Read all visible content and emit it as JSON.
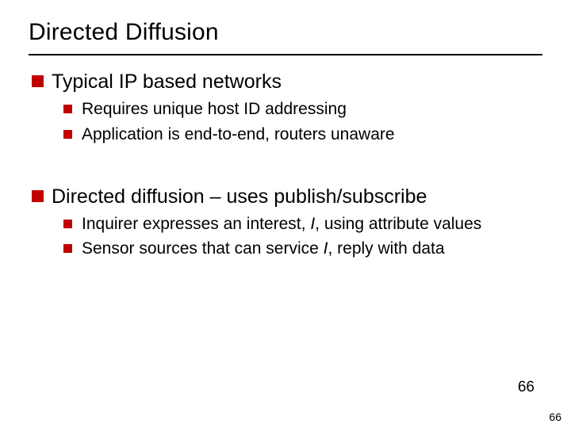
{
  "title": "Directed Diffusion",
  "sections": [
    {
      "heading": "Typical IP based networks",
      "items": [
        {
          "text": "Requires unique host ID addressing"
        },
        {
          "text": "Application is end-to-end, routers unaware"
        }
      ]
    },
    {
      "heading": "Directed diffusion – uses publish/subscribe",
      "items": [
        {
          "pre": "Inquirer expresses an interest, ",
          "em": "I",
          "post": ", using attribute values"
        },
        {
          "pre": "Sensor sources that can service ",
          "em": "I",
          "post": ", reply with data"
        }
      ]
    }
  ],
  "page_number_inner": "66",
  "page_number_outer": "66",
  "colors": {
    "accent": "#c00000"
  }
}
